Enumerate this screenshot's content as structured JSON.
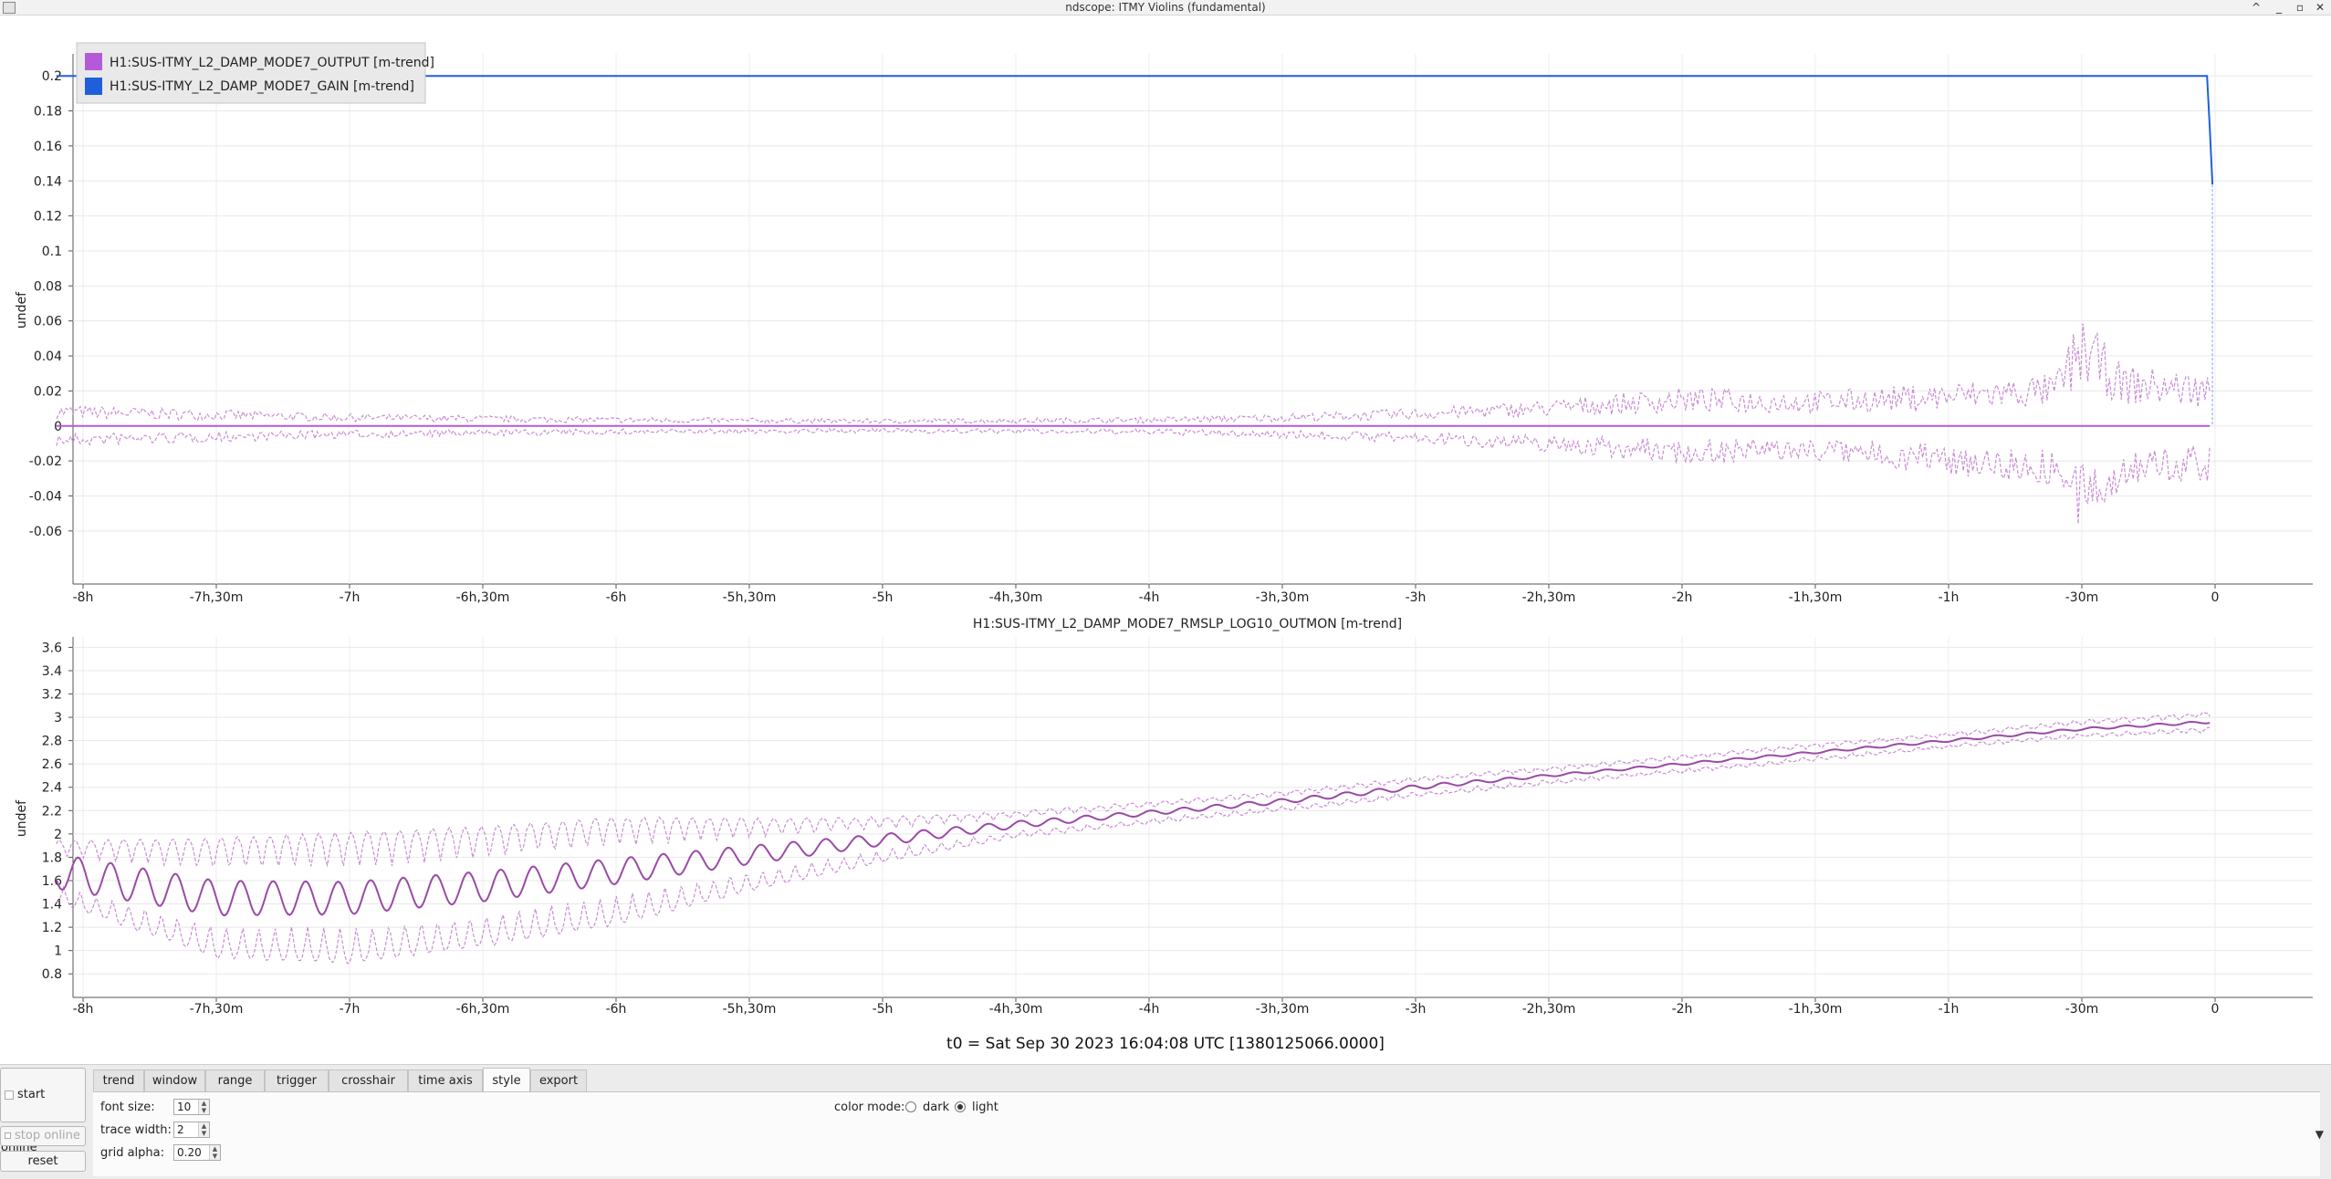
{
  "window": {
    "title": "ndscope: ITMY Violins (fundamental)",
    "controls": [
      "^",
      "_",
      "▫",
      "✕"
    ]
  },
  "colors": {
    "output_trace": "#b45ad8",
    "gain_trace": "#1f5fdc",
    "rms_trace": "#9a4aa6",
    "rms_band": "#c98ed4",
    "axis": "#555555"
  },
  "x_tick_labels": [
    "-8h",
    "-7h,30m",
    "-7h",
    "-6h,30m",
    "-6h",
    "-5h,30m",
    "-5h",
    "-4h,30m",
    "-4h",
    "-3h,30m",
    "-3h",
    "-2h,30m",
    "-2h",
    "-1h,30m",
    "-1h",
    "-30m",
    "0"
  ],
  "chart_data": [
    {
      "type": "line",
      "title": "",
      "ylabel": "undef",
      "ylim": [
        -0.07,
        0.21
      ],
      "y_ticks": [
        "0.2",
        "0.18",
        "0.16",
        "0.14",
        "0.12",
        "0.1",
        "0.08",
        "0.06",
        "0.04",
        "0.02",
        "0",
        "-0.02",
        "-0.04",
        "-0.06"
      ],
      "x_range_hours": [
        -8,
        0
      ],
      "grid": true,
      "legend_position": "top-left",
      "series": [
        {
          "name": "H1:SUS-ITMY_L2_DAMP_MODE7_OUTPUT [m-trend]",
          "color": "#b45ad8",
          "mean": {
            "x_hours": [
              -8.1,
              -0.02
            ],
            "y": [
              0,
              0
            ]
          },
          "envelope": {
            "x_hours": [
              -8.1,
              -7,
              -6,
              -5,
              -4,
              -3.5,
              -3,
              -2.5,
              -2,
              -1.5,
              -1,
              -0.6,
              -0.5,
              -0.35,
              -0.02
            ],
            "max": [
              0.012,
              0.007,
              0.005,
              0.004,
              0.005,
              0.007,
              0.01,
              0.015,
              0.022,
              0.02,
              0.025,
              0.03,
              0.065,
              0.035,
              0.03
            ],
            "min": [
              -0.012,
              -0.007,
              -0.005,
              -0.004,
              -0.005,
              -0.007,
              -0.01,
              -0.015,
              -0.022,
              -0.02,
              -0.028,
              -0.035,
              -0.065,
              -0.035,
              -0.032
            ]
          }
        },
        {
          "name": "H1:SUS-ITMY_L2_DAMP_MODE7_GAIN [m-trend]",
          "color": "#1f5fdc",
          "x_hours": [
            -8.1,
            -0.03,
            -0.02,
            -0.01
          ],
          "y": [
            0.2,
            0.2,
            0.17,
            0.138
          ]
        }
      ]
    },
    {
      "type": "line",
      "title": "H1:SUS-ITMY_L2_DAMP_MODE7_RMSLP_LOG10_OUTMON [m-trend]",
      "ylabel": "undef",
      "ylim": [
        0.7,
        3.65
      ],
      "y_ticks": [
        "3.6",
        "3.4",
        "3.2",
        "3",
        "2.8",
        "2.6",
        "2.4",
        "2.2",
        "2",
        "1.8",
        "1.6",
        "1.4",
        "1.2",
        "1",
        "0.8"
      ],
      "x_range_hours": [
        -8,
        0
      ],
      "grid": true,
      "series": [
        {
          "name": "H1:SUS-ITMY_L2_DAMP_MODE7_RMSLP_LOG10_OUTMON [m-trend]",
          "x_hours": [
            -8.1,
            -7.5,
            -7,
            -6.5,
            -6,
            -5.5,
            -5,
            -4.5,
            -4,
            -3.5,
            -3,
            -2.5,
            -2,
            -1.5,
            -1,
            -0.5,
            -0.02
          ],
          "mean": [
            1.68,
            1.45,
            1.45,
            1.55,
            1.68,
            1.82,
            1.95,
            2.08,
            2.18,
            2.28,
            2.4,
            2.5,
            2.6,
            2.7,
            2.8,
            2.9,
            2.96
          ],
          "osc_amplitude": [
            0.15,
            0.15,
            0.14,
            0.13,
            0.11,
            0.08,
            0.05,
            0.03,
            0.02,
            0.02,
            0.02,
            0.01,
            0.01,
            0.01,
            0.01,
            0.01,
            0.01
          ],
          "envelope_halfwidth": [
            0.25,
            0.5,
            0.55,
            0.5,
            0.45,
            0.3,
            0.18,
            0.1,
            0.08,
            0.07,
            0.07,
            0.06,
            0.06,
            0.06,
            0.05,
            0.06,
            0.07
          ]
        }
      ]
    }
  ],
  "t0_text": "t0 = Sat Sep 30 2023 16:04:08 UTC [1380125066.0000]",
  "side_buttons": {
    "start_online": "start online",
    "stop_online": "stop online",
    "reset": "reset"
  },
  "tabs": [
    {
      "label": "trend",
      "active": false
    },
    {
      "label": "window",
      "active": false
    },
    {
      "label": "range",
      "active": false
    },
    {
      "label": "trigger",
      "active": false
    },
    {
      "label": "crosshair",
      "active": false
    },
    {
      "label": "time axis",
      "active": false
    },
    {
      "label": "style",
      "active": true
    },
    {
      "label": "export",
      "active": false
    }
  ],
  "style_tab": {
    "font_size_label": "font size:",
    "font_size_value": "10",
    "trace_width_label": "trace width:",
    "trace_width_value": "2",
    "grid_alpha_label": "grid alpha:",
    "grid_alpha_value": "0.20",
    "color_mode_label": "color mode:",
    "dark_label": "dark",
    "light_label": "light",
    "color_mode_selected": "light"
  }
}
